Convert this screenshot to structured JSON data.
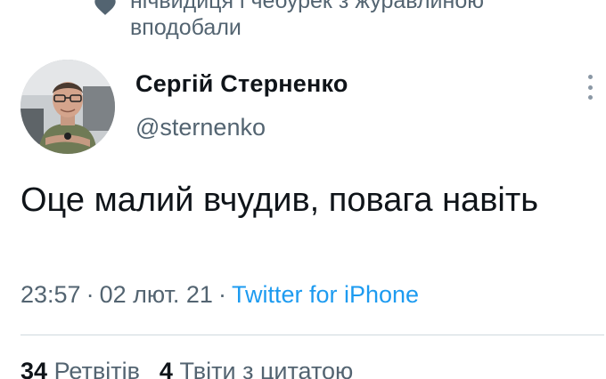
{
  "social_context": {
    "icon": "heart-icon",
    "text": "нічвидиця і чебурек з журавлиною вподобали"
  },
  "tweet": {
    "author_name": "Сергій Стерненко",
    "author_handle": "@sternenko",
    "text": "Оце малий вчудив, повага навіть",
    "time": "23:57",
    "separator": "·",
    "date": "02 лют. 21",
    "source": "Twitter for iPhone"
  },
  "stats": {
    "retweets_count": "34",
    "retweets_label": "Ретвітів",
    "quotes_count": "4",
    "quotes_label": "Твіти з цитатою"
  },
  "colors": {
    "secondary_text": "#536471",
    "link": "#1d9bf0",
    "primary_text": "#0f1419"
  }
}
